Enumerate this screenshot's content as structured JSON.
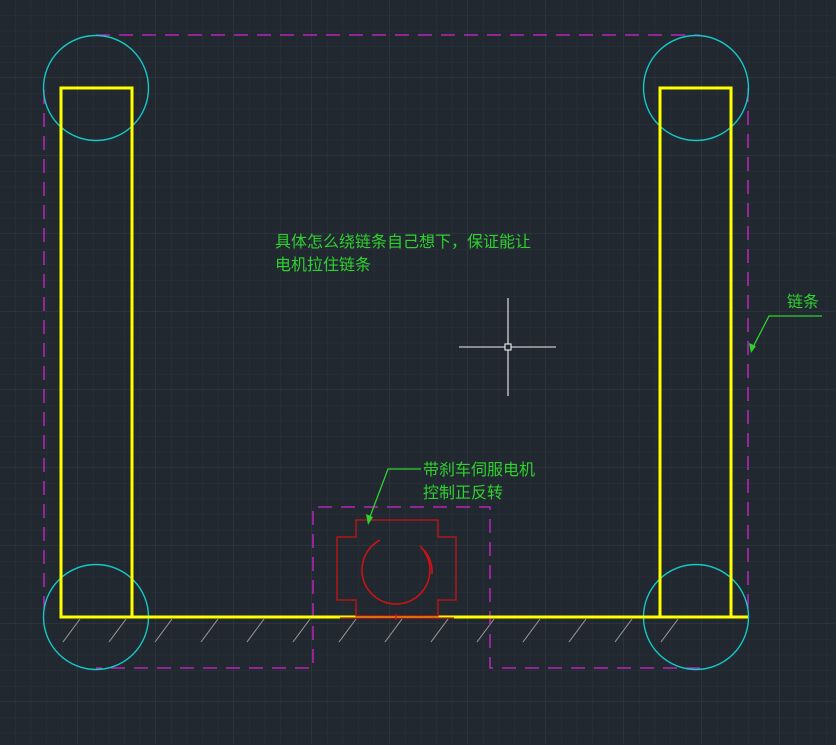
{
  "annotations": {
    "main_note": {
      "line1": "具体怎么绕链条自己想下，保证能让",
      "line2": "电机拉住链条"
    },
    "chain_label": "链条",
    "motor_note": {
      "line1": "带刹车伺服电机",
      "line2": "控制正反转"
    }
  },
  "colors": {
    "background": "#212830",
    "frame": "#ffff00",
    "chain": "#d026d0",
    "sprocket": "#14c8c8",
    "motor": "#c81414",
    "text": "#2fd12f",
    "cursor": "#f0f0f0",
    "hatch": "#9a9a9a"
  },
  "icons": {
    "cursor": "crosshair-cursor-icon"
  }
}
